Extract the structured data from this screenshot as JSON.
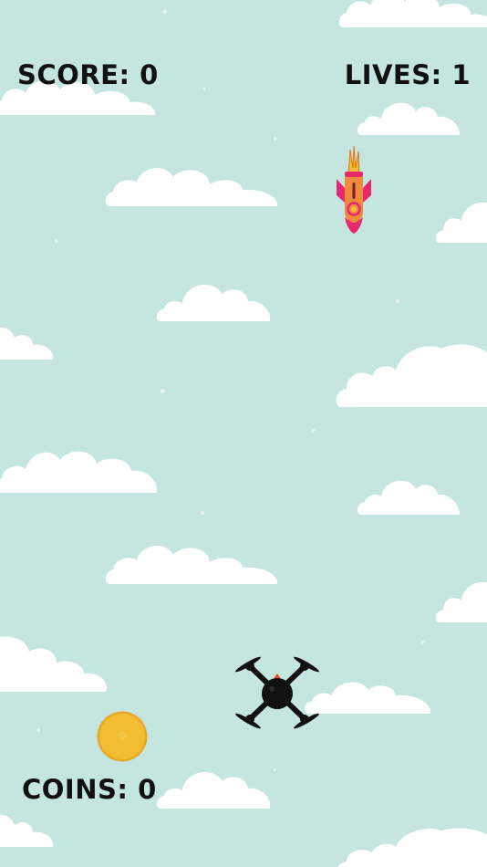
{
  "hud": {
    "score_label": "SCORE: 0",
    "lives_label": "LIVES: 1",
    "coins_label": "COINS: 0"
  },
  "game_state": {
    "score": 0,
    "lives": 1,
    "coins": 0
  },
  "sprites": {
    "player": "drone-icon",
    "enemy": "rocket-icon",
    "pickup": "coin-icon",
    "background": "cloud"
  },
  "colors": {
    "sky": "#c5e6e0",
    "cloud": "#ffffff",
    "hud_text": "#111111",
    "coin": "#f2bd33",
    "rocket_body": "#f08a3c",
    "rocket_accent": "#e52a6c",
    "drone": "#111111"
  }
}
